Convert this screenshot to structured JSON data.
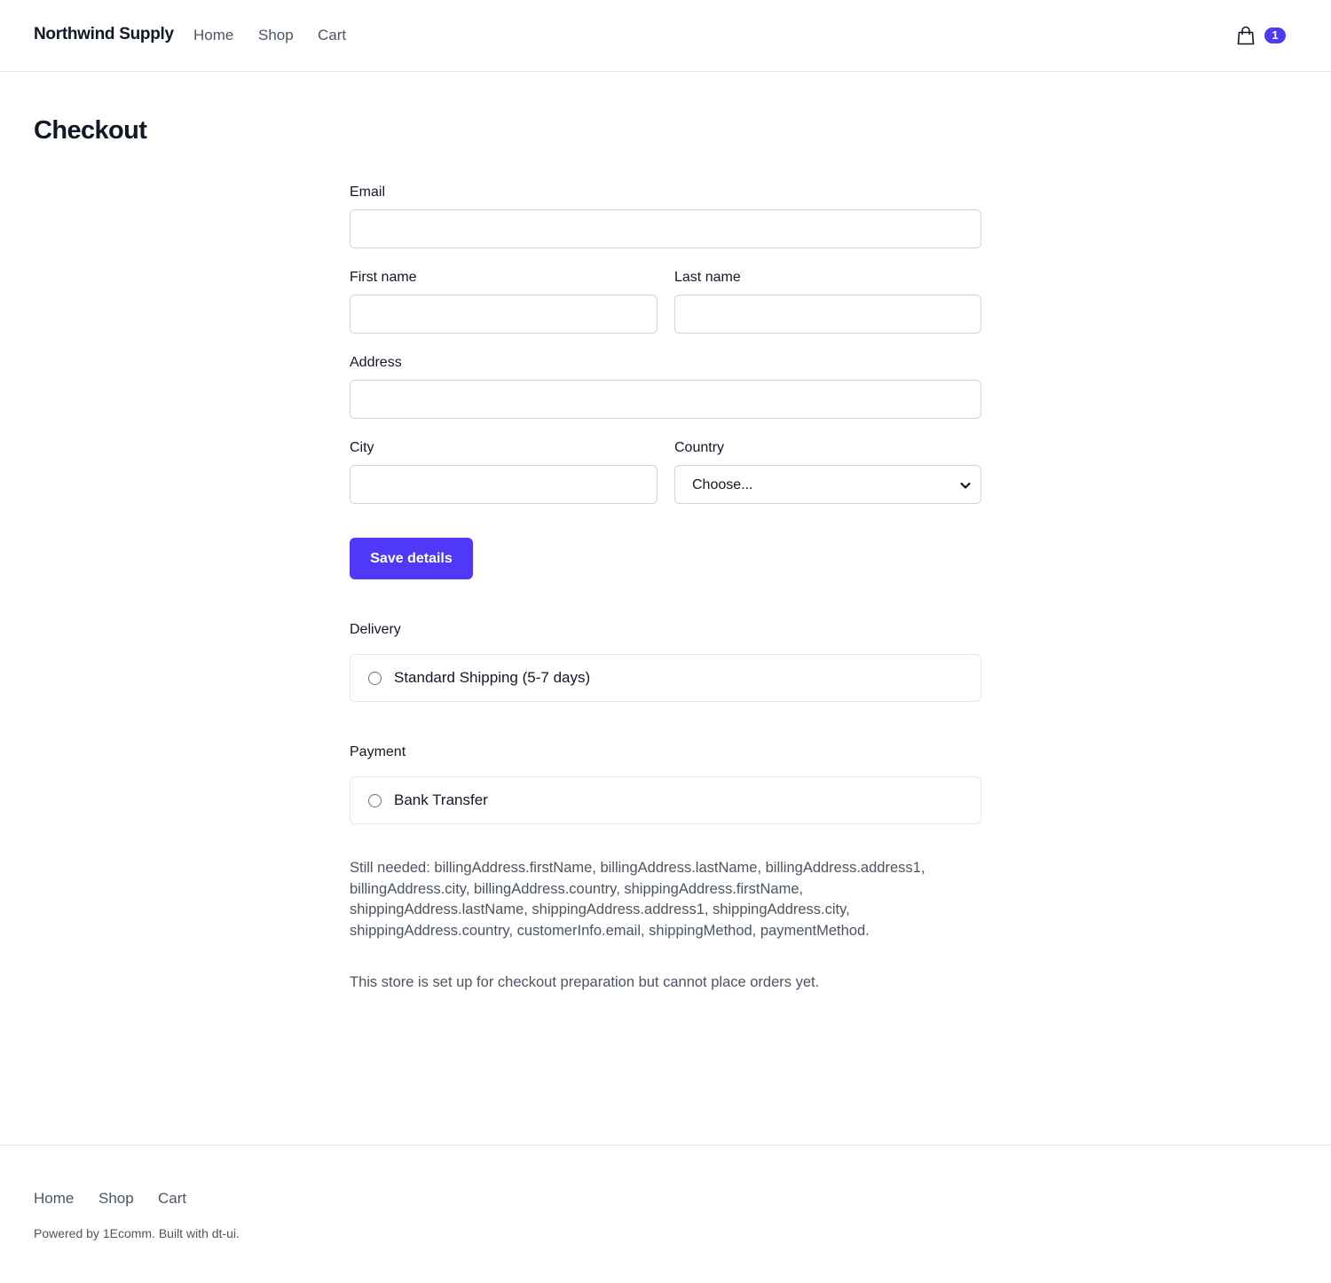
{
  "header": {
    "brand": "Northwind Supply",
    "nav": [
      "Home",
      "Shop",
      "Cart"
    ],
    "cart_icon": "shopping-bag-icon",
    "cart_count": "1"
  },
  "page_title": "Checkout",
  "form": {
    "email_label": "Email",
    "email_value": "",
    "first_name_label": "First name",
    "first_name_value": "",
    "last_name_label": "Last name",
    "last_name_value": "",
    "address_label": "Address",
    "address_value": "",
    "city_label": "City",
    "city_value": "",
    "country_label": "Country",
    "country_selected": "Choose...",
    "save_label": "Save details"
  },
  "delivery": {
    "label": "Delivery",
    "options": [
      {
        "label": "Standard Shipping (5-7 days)",
        "selected": false
      }
    ]
  },
  "payment": {
    "label": "Payment",
    "options": [
      {
        "label": "Bank Transfer",
        "selected": false
      }
    ]
  },
  "still_needed": "Still needed: billingAddress.firstName, billingAddress.lastName, billingAddress.address1, billingAddress.city, billingAddress.country, shippingAddress.firstName, shippingAddress.lastName, shippingAddress.address1, shippingAddress.city, shippingAddress.country, customerInfo.email, shippingMethod, paymentMethod.",
  "notice": "This store is set up for checkout preparation but cannot place orders yet.",
  "footer": {
    "nav": [
      "Home",
      "Shop",
      "Cart"
    ],
    "powered_by": "Powered by 1Ecomm. Built with dt-ui."
  },
  "colors": {
    "accent": "#4f39f6",
    "text": "#111827",
    "muted": "#4b5563",
    "border": "#d1d5db"
  }
}
